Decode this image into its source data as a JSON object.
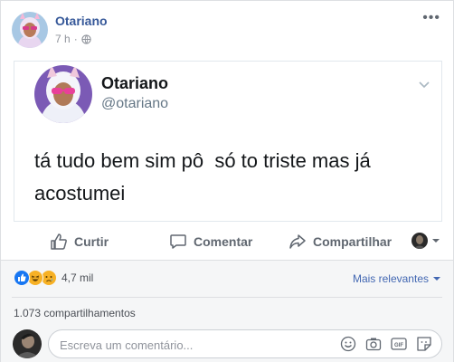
{
  "post": {
    "author": "Otariano",
    "time": "7 h",
    "time_sep": "·"
  },
  "tweet": {
    "name": "Otariano",
    "handle": "@otariano",
    "text": "tá tudo bem sim pô  só to triste mas já acostumei"
  },
  "actions": {
    "like": "Curtir",
    "comment": "Comentar",
    "share": "Compartilhar"
  },
  "reactions": {
    "count": "4,7 mil",
    "types": [
      "like-icon",
      "haha-icon",
      "sad-icon"
    ]
  },
  "sort": {
    "label": "Mais relevantes"
  },
  "shares": {
    "label": "1.073 compartilhamentos"
  },
  "comment": {
    "placeholder": "Escreva um comentário..."
  },
  "colors": {
    "link_blue": "#365899",
    "accent_blue": "#4267b2",
    "like_blue": "#1877f2",
    "haha_yellow": "#f7b125",
    "grey_text": "#606770"
  }
}
